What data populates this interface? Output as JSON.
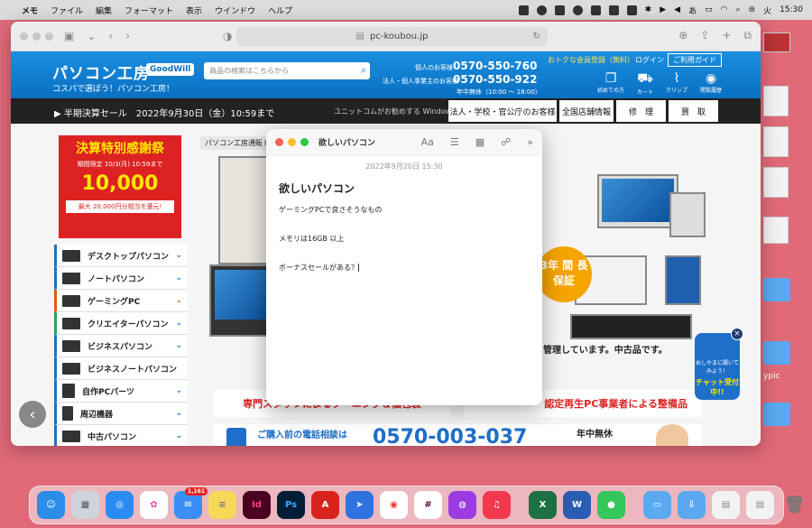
{
  "menubar": {
    "app": "メモ",
    "items": [
      "ファイル",
      "編集",
      "フォーマット",
      "表示",
      "ウインドウ",
      "ヘルプ"
    ],
    "day": "火",
    "time": "15:30"
  },
  "desktop": {
    "label": "ypic"
  },
  "browser": {
    "url": "pc-koubou.jp"
  },
  "site": {
    "logo": "パソコン工房",
    "logo_badge": "GoodWill",
    "tagline": "コスパで選ぼう！パソコン工房！",
    "search_placeholder": "商品の検索はこちらから",
    "phone_personal_label": "個人のお客様",
    "phone_personal": "0570-550-760",
    "phone_business_label": "法人・個人事業主のお客様",
    "phone_business": "0570-550-922",
    "hours": "年中無休（10:00 ～ 18:00）",
    "promo": "おトクな会員登録（無料）",
    "login": "ログイン",
    "guide": "ご利用ガイド",
    "header_icons": [
      "初めての方",
      "カート",
      "クリップ",
      "閲覧履歴"
    ],
    "sale_text": "半期決算セール　2022年9月30日（金）10:59まで",
    "windows_note": "ユニットコムがお勧めする Windows.",
    "nav_buttons": [
      "法人・学校・官公庁のお客様",
      "全国店舗情報",
      "修　理",
      "買　取"
    ],
    "banner": {
      "title": "決算特別感謝祭",
      "period": "期間限定 10/3(月) 10:59まで",
      "amount": "10,000",
      "note": "最大 20,000円分相当を還元!"
    },
    "breadcrumb": "パソコン工房通販ト",
    "categories": [
      "デスクトップパソコン",
      "ノートパソコン",
      "ゲーミングPC",
      "クリエイターパソコン",
      "ビジネスパソコン",
      "ビジネスノートパソコン",
      "自作PCパーツ",
      "周辺機器",
      "中古パソコン"
    ],
    "category_colors": [
      "#1e6fc8",
      "#1e6fc8",
      "#e05a10",
      "#2aa15c",
      "#1e6fc8",
      "#1e6fc8",
      "#1e6fc8",
      "#1e6fc8",
      "#1e6fc8"
    ],
    "hero_badge": "3年 間 長保証",
    "hero_text": "管理しています。中古品です。",
    "ribbon_left": "専門スタッフによるクーニング＆個包装",
    "ribbon_right": "認定再生PC事業者による整備品",
    "phone_strip_lead": "ご購入前の電話相談は",
    "phone_strip_number": "0570-003-037",
    "phone_strip_hours": "年中無休",
    "chat_small": "めしやまに聞いてみよう！",
    "chat_big": "チャット受付中!!"
  },
  "notes": {
    "window_title": "欲しいパソコン",
    "date": "2022年9月20日 15:30",
    "heading": "欲しいパソコン",
    "lines": [
      "ゲーミングPCで良さそうなもの",
      "",
      "メモリは16GB 以上",
      "",
      "ボーナスセールがある？"
    ]
  },
  "dock": {
    "mail_badge": "1,161",
    "apps": [
      {
        "name": "Finder",
        "color": "#2b8de8",
        "glyph": "☺"
      },
      {
        "name": "Launchpad",
        "color": "#cfd4dc",
        "glyph": "▦"
      },
      {
        "name": "Safari",
        "color": "#2a8cf2",
        "glyph": "◎"
      },
      {
        "name": "Photos",
        "color": "#ffffff",
        "glyph": "✿"
      },
      {
        "name": "Mail",
        "color": "#3a8ef5",
        "glyph": "✉"
      },
      {
        "name": "Notes",
        "color": "#f7d95a",
        "glyph": "≡"
      },
      {
        "name": "InDesign",
        "color": "#49021f",
        "glyph": "Id"
      },
      {
        "name": "Photoshop",
        "color": "#001e36",
        "glyph": "Ps"
      },
      {
        "name": "Acrobat",
        "color": "#d8231c",
        "glyph": "A"
      },
      {
        "name": "Maps",
        "color": "#2f73e0",
        "glyph": "➤"
      },
      {
        "name": "Chrome",
        "color": "#ffffff",
        "glyph": "◉"
      },
      {
        "name": "Slack",
        "color": "#ffffff",
        "glyph": "#"
      },
      {
        "name": "Podcasts",
        "color": "#9b3be0",
        "glyph": "◍"
      },
      {
        "name": "Music",
        "color": "#f2394d",
        "glyph": "♫"
      },
      {
        "name": "Excel",
        "color": "#1d7044",
        "glyph": "X"
      },
      {
        "name": "Word",
        "color": "#2a5cb3",
        "glyph": "W"
      },
      {
        "name": "Messages",
        "color": "#34c759",
        "glyph": "●"
      }
    ]
  }
}
